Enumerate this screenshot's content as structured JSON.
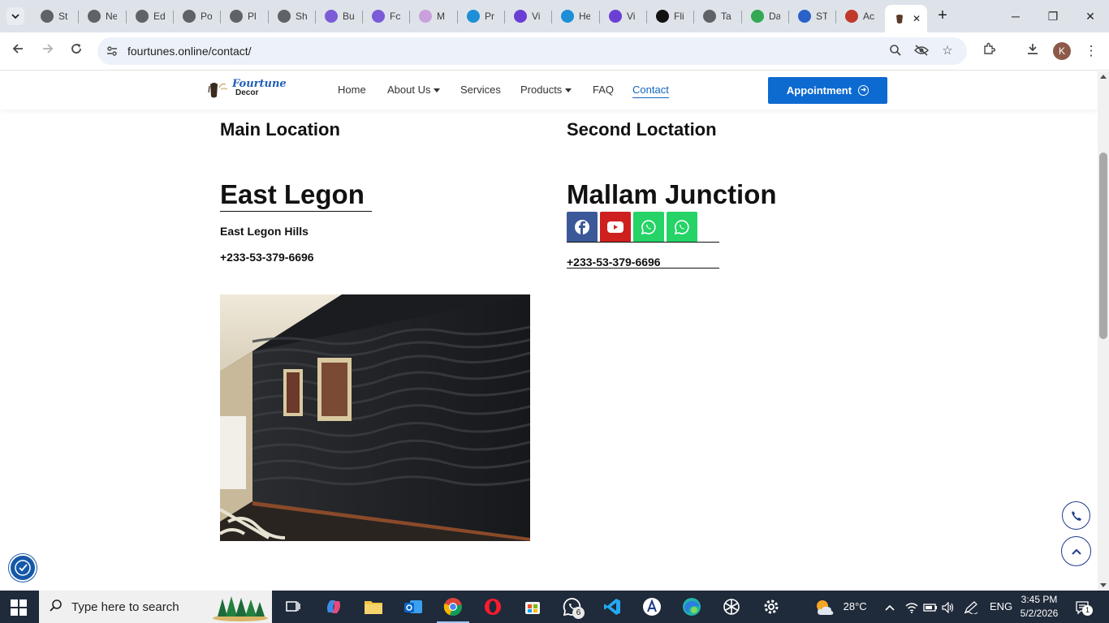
{
  "browser": {
    "tabs": [
      {
        "label": "St",
        "icon": "globe-icon",
        "color": "#5f6368"
      },
      {
        "label": "Ne",
        "icon": "github-icon",
        "color": "#5f6368"
      },
      {
        "label": "Ed",
        "icon": "globe-icon",
        "color": "#5f6368"
      },
      {
        "label": "Po",
        "icon": "globe-icon",
        "color": "#5f6368"
      },
      {
        "label": "Pl",
        "icon": "globe-icon",
        "color": "#5f6368"
      },
      {
        "label": "Sh",
        "icon": "globe-icon",
        "color": "#5f6368"
      },
      {
        "label": "Bu",
        "icon": "copilot-icon",
        "color": "#7b5cd6"
      },
      {
        "label": "Fc",
        "icon": "copilot-icon",
        "color": "#7b5cd6"
      },
      {
        "label": "M",
        "icon": "meta-icon",
        "color": "#c9a0dc"
      },
      {
        "label": "Pr",
        "icon": "canva-icon",
        "color": "#1d8fd8"
      },
      {
        "label": "Vi",
        "icon": "heart-shield-icon",
        "color": "#6b3fd4"
      },
      {
        "label": "He",
        "icon": "canva-icon",
        "color": "#1d8fd8"
      },
      {
        "label": "Vi",
        "icon": "heart-shield-icon",
        "color": "#6b3fd4"
      },
      {
        "label": "Fli",
        "icon": "triangle-icon",
        "color": "#111111"
      },
      {
        "label": "Ta",
        "icon": "globe-icon",
        "color": "#5f6368"
      },
      {
        "label": "Da",
        "icon": "maps-pin-icon",
        "color": "#34a853"
      },
      {
        "label": "ST",
        "icon": "stack-icon",
        "color": "#2a62c9"
      },
      {
        "label": "Ac",
        "icon": "doc-icon",
        "color": "#c0392b"
      }
    ],
    "active_tab_icon": "fourtune-favicon-icon",
    "url": "fourtunes.online/contact/",
    "profile_initial": "K"
  },
  "site": {
    "logo": {
      "line1": "Fourtune",
      "line2": "Decor"
    },
    "nav": {
      "home": "Home",
      "about": "About Us",
      "services": "Services",
      "products": "Products",
      "faq": "FAQ",
      "contact": "Contact"
    },
    "appointment_label": "Appointment",
    "main_location": {
      "heading": "Main Location",
      "place": "East Legon",
      "address": "East Legon Hills",
      "phone": "+233-53-379-6696"
    },
    "second_location": {
      "heading": "Second Loctation",
      "place": "Mallam Junction",
      "phone": "+233-53-379-6696"
    },
    "social": [
      {
        "name": "facebook",
        "color": "#3b5998"
      },
      {
        "name": "youtube",
        "color": "#cd201f"
      },
      {
        "name": "whatsapp",
        "color": "#25d366"
      },
      {
        "name": "whatsapp",
        "color": "#25d366"
      }
    ],
    "accent_color": "#0d6ad1"
  },
  "taskbar": {
    "search_placeholder": "Type here to search",
    "whatsapp_badge": "6",
    "weather": "28°C",
    "language": "ENG",
    "time": "3:45 PM",
    "date": "5/2/2026",
    "notification_count": "1"
  }
}
